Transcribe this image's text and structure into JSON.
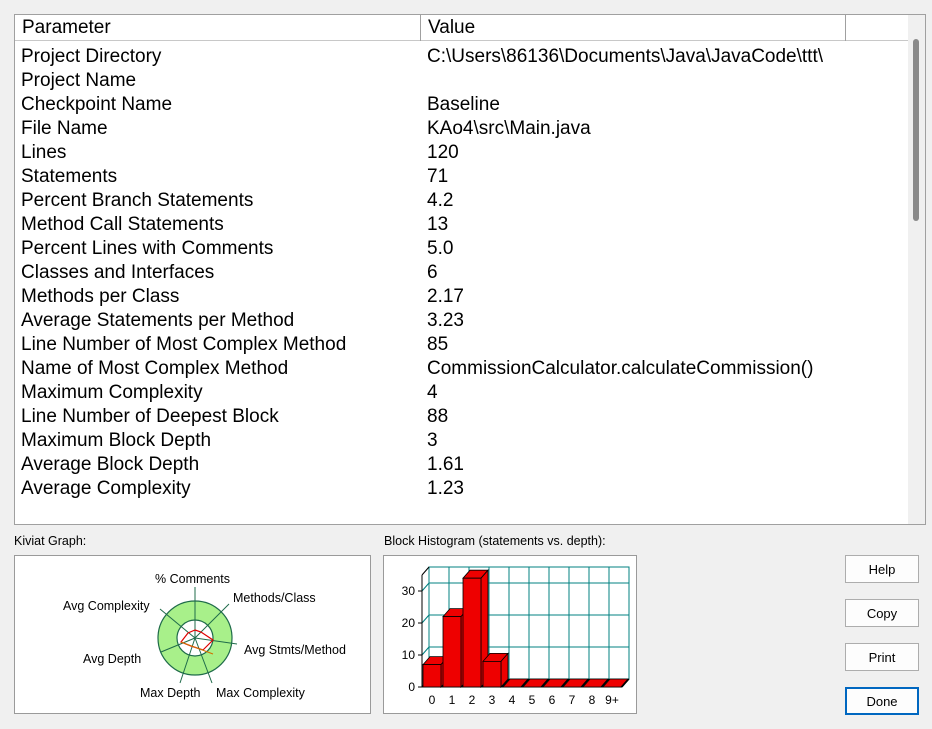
{
  "table": {
    "headers": {
      "parameter": "Parameter",
      "value": "Value"
    },
    "rows": [
      {
        "name": "Project Directory",
        "value": "C:\\Users\\86136\\Documents\\Java\\JavaCode\\ttt\\"
      },
      {
        "name": "Project Name",
        "value": ""
      },
      {
        "name": "Checkpoint Name",
        "value": "Baseline"
      },
      {
        "name": "File Name",
        "value": "KAo4\\src\\Main.java"
      },
      {
        "name": "Lines",
        "value": "120"
      },
      {
        "name": "Statements",
        "value": "71"
      },
      {
        "name": "Percent Branch Statements",
        "value": "4.2"
      },
      {
        "name": "Method Call Statements",
        "value": "13"
      },
      {
        "name": "Percent Lines with Comments",
        "value": "5.0"
      },
      {
        "name": "Classes and Interfaces",
        "value": "6"
      },
      {
        "name": "Methods per Class",
        "value": "2.17"
      },
      {
        "name": "Average Statements per Method",
        "value": "3.23"
      },
      {
        "name": "Line Number of Most Complex Method",
        "value": "85"
      },
      {
        "name": "Name of Most Complex Method",
        "value": "CommissionCalculator.calculateCommission()"
      },
      {
        "name": "Maximum Complexity",
        "value": "4"
      },
      {
        "name": "Line Number of Deepest Block",
        "value": "88"
      },
      {
        "name": "Maximum Block Depth",
        "value": "3"
      },
      {
        "name": "Average Block Depth",
        "value": "1.61"
      },
      {
        "name": "Average Complexity",
        "value": "1.23"
      }
    ]
  },
  "kiviat": {
    "label": "Kiviat Graph:",
    "axes": [
      "% Comments",
      "Methods/Class",
      "Avg Stmts/Method",
      "Max Complexity",
      "Max Depth",
      "Avg Depth",
      "Avg Complexity"
    ],
    "colors": {
      "outer_ring": "#a8f08a",
      "inner_ring": "#ffffff",
      "stroke": "#1f6b4a",
      "polygon": "#e00000"
    }
  },
  "histogram": {
    "label": "Block Histogram (statements vs. depth):",
    "colors": {
      "bar": "#ee0000",
      "grid": "#008080"
    }
  },
  "chart_data": {
    "type": "bar",
    "title": "Block Histogram (statements vs. depth):",
    "categories": [
      "0",
      "1",
      "2",
      "3",
      "4",
      "5",
      "6",
      "7",
      "8",
      "9+"
    ],
    "values": [
      7,
      22,
      34,
      8,
      0,
      0,
      0,
      0,
      0,
      0
    ],
    "ylim": [
      0,
      35
    ],
    "yticks": [
      0,
      10,
      20,
      30
    ],
    "xlabel": "",
    "ylabel": "",
    "grid": true
  },
  "buttons": {
    "help": "Help",
    "copy": "Copy",
    "print": "Print",
    "done": "Done"
  }
}
